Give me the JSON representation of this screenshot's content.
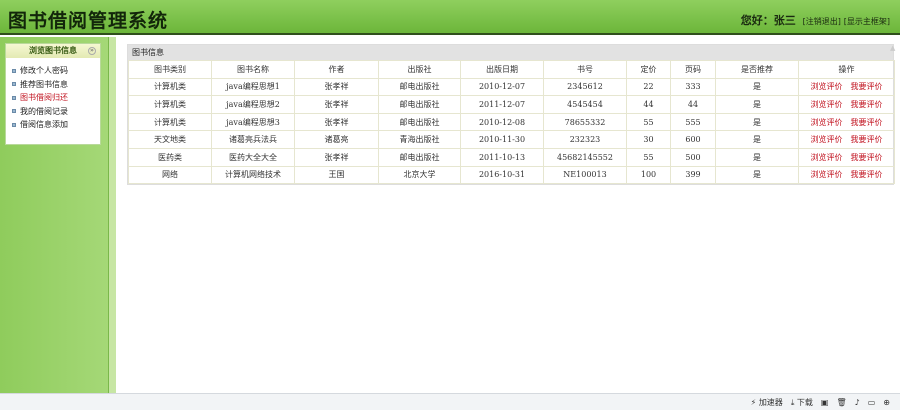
{
  "header": {
    "title": "图书借阅管理系统",
    "greeting": "您好：张三",
    "logout": "[注销退出]",
    "main_frame": "[显示主框架]"
  },
  "sidebar": {
    "panel_title": "浏览图书信息",
    "items": [
      {
        "label": "修改个人密码"
      },
      {
        "label": "推荐图书信息"
      },
      {
        "label": "图书借阅归还"
      },
      {
        "label": "我的借阅记录"
      },
      {
        "label": "借阅信息添加"
      }
    ]
  },
  "content": {
    "title": "图书信息",
    "columns": [
      "图书类别",
      "图书名称",
      "作者",
      "出版社",
      "出版日期",
      "书号",
      "定价",
      "页码",
      "是否推荐",
      "操作"
    ],
    "rows": [
      [
        "计算机类",
        "java编程思想1",
        "张孝祥",
        "邮电出版社",
        "2010-12-07",
        "2345612",
        "22",
        "333",
        "是"
      ],
      [
        "计算机类",
        "java编程思想2",
        "张孝祥",
        "邮电出版社",
        "2011-12-07",
        "4545454",
        "44",
        "44",
        "是"
      ],
      [
        "计算机类",
        "java编程思想3",
        "张孝祥",
        "邮电出版社",
        "2010-12-08",
        "78655332",
        "55",
        "555",
        "是"
      ],
      [
        "天文地类",
        "诸葛亮兵法兵",
        "诸葛亮",
        "青海出版社",
        "2010-11-30",
        "232323",
        "30",
        "600",
        "是"
      ],
      [
        "医药类",
        "医药大全大全",
        "张孝祥",
        "邮电出版社",
        "2011-10-13",
        "45682145552",
        "55",
        "500",
        "是"
      ],
      [
        "网络",
        "计算机网络技术",
        "王国",
        "北京大学",
        "2016-10-31",
        "NE100013",
        "100",
        "399",
        "是"
      ]
    ],
    "action_view": "浏览评价",
    "action_rate": "我要评价"
  },
  "statusbar": {
    "accelerator": "加速器",
    "download": "下载"
  },
  "watermark": "https://www.huzhan.com/ishop30884"
}
